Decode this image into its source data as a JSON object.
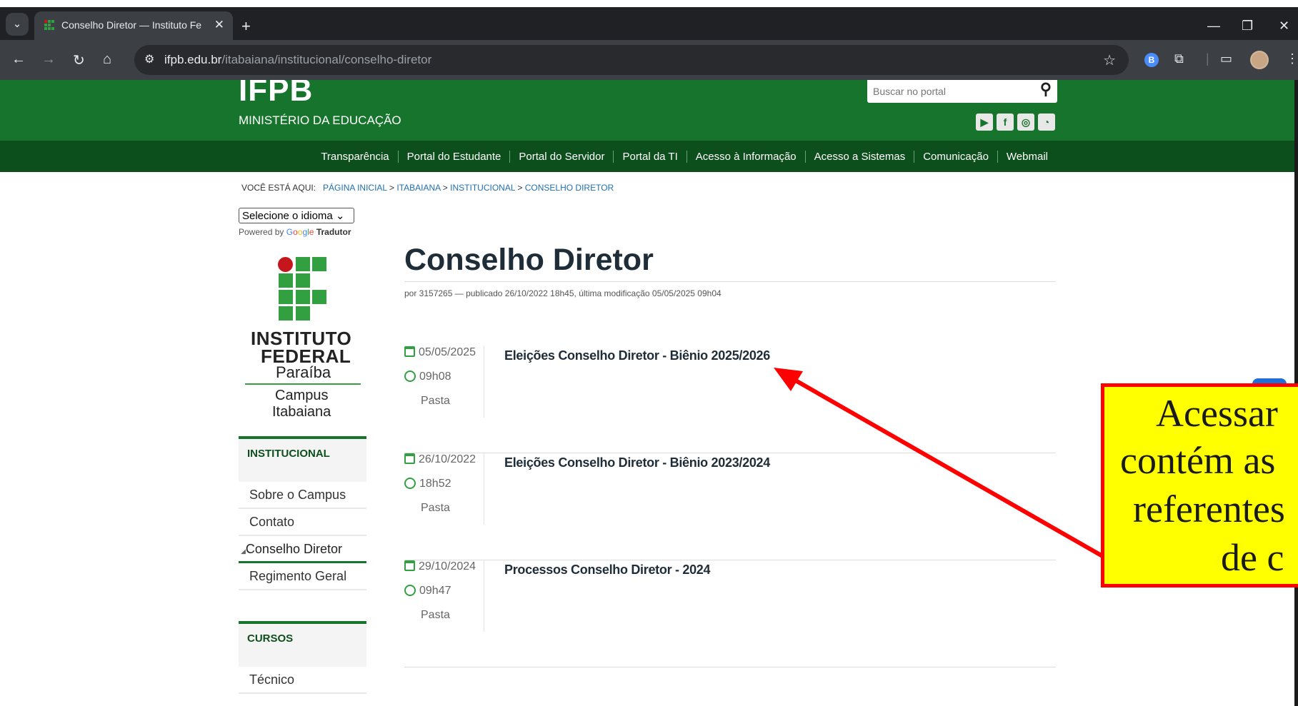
{
  "browser": {
    "tab_title": "Conselho Diretor — Instituto Fe",
    "url_domain": "ifpb.edu.br",
    "url_path": "/itabaiana/institucional/conselho-diretor"
  },
  "site": {
    "logo_text": "IFPB",
    "ministry": "MINISTÉRIO DA EDUCAÇÃO",
    "search_placeholder": "Buscar no portal",
    "nav": [
      "Transparência",
      "Portal do Estudante",
      "Portal do Servidor",
      "Portal da TI",
      "Acesso à Informação",
      "Acesso a Sistemas",
      "Comunicação",
      "Webmail"
    ]
  },
  "breadcrumb": {
    "label": "VOCÊ ESTÁ AQUI:",
    "items": [
      "PÁGINA INICIAL",
      "ITABAIANA",
      "INSTITUCIONAL",
      "CONSELHO DIRETOR"
    ]
  },
  "translate": {
    "select_label": "Selecione o idioma",
    "powered_by": "Powered by",
    "tradutor": "Tradutor"
  },
  "campus_logo": {
    "line1": "INSTITUTO",
    "line2": "FEDERAL",
    "line3": "Paraíba",
    "line4": "Campus",
    "line5": "Itabaiana"
  },
  "sidebar": {
    "institucional_title": "INSTITUCIONAL",
    "items": [
      "Sobre o Campus",
      "Contato",
      "Conselho Diretor",
      "Regimento Geral"
    ],
    "cursos_title": "CURSOS",
    "cursos_items": [
      "Técnico"
    ]
  },
  "main": {
    "title": "Conselho Diretor",
    "byline": "por 3157265 — publicado 26/10/2022 18h45, última modificação 05/05/2025 09h04",
    "entries": [
      {
        "date": "05/05/2025",
        "time": "09h08",
        "type": "Pasta",
        "title": "Eleições Conselho Diretor - Biênio 2025/2026"
      },
      {
        "date": "26/10/2022",
        "time": "18h52",
        "type": "Pasta",
        "title": "Eleições Conselho Diretor - Biênio 2023/2024"
      },
      {
        "date": "29/10/2024",
        "time": "09h47",
        "type": "Pasta",
        "title": "Processos Conselho Diretor - 2024"
      }
    ]
  },
  "annotation": {
    "lines": [
      "Acessar",
      "contém as",
      "referentes",
      "de c"
    ],
    "box_color": "#ffff00",
    "border_color": "#ff0000",
    "arrow_color": "#ff0000"
  },
  "colors": {
    "header_green": "#17742d",
    "menu_dark_green": "#0d4f1c",
    "browser_dark": "#202124"
  }
}
